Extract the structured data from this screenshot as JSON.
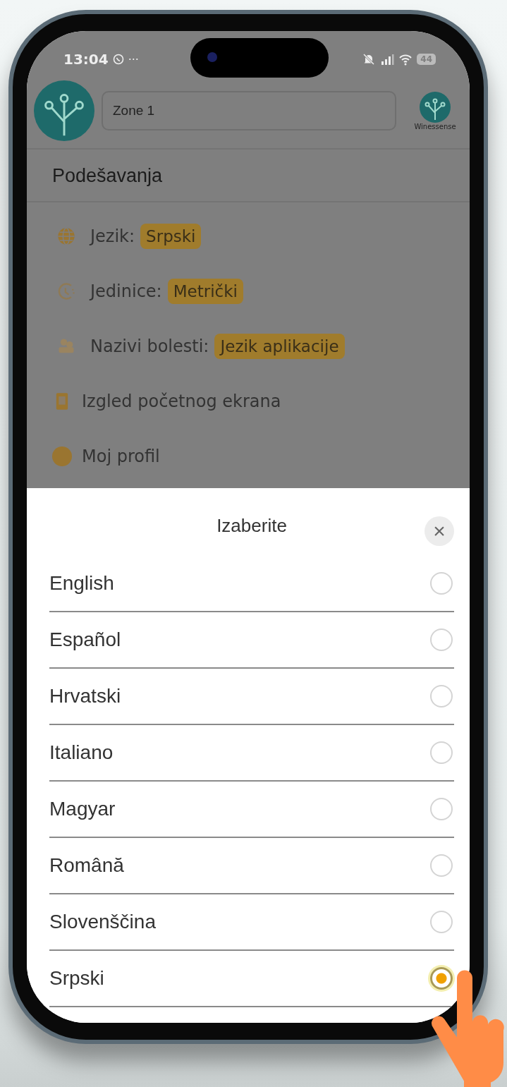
{
  "status_bar": {
    "time": "13:04",
    "more": "···",
    "battery": "44"
  },
  "header": {
    "zone_field": {
      "value": "Zone 1"
    },
    "brand_label": "Winessense"
  },
  "title": "Podešavanja",
  "settings": [
    {
      "kind": "globe",
      "label": "Jezik:",
      "value": "Srpski"
    },
    {
      "kind": "units",
      "label": "Jedinice:",
      "value": "Metrički"
    },
    {
      "kind": "disease",
      "label": "Nazivi bolesti:",
      "value": "Jezik aplikacije"
    },
    {
      "kind": "screen",
      "label": "Izgled početnog ekrana"
    },
    {
      "kind": "profile",
      "label": "Moj profil"
    }
  ],
  "sheet": {
    "title": "Izaberite",
    "close": "×",
    "options": [
      {
        "label": "English",
        "selected": false
      },
      {
        "label": "Español",
        "selected": false
      },
      {
        "label": "Hrvatski",
        "selected": false
      },
      {
        "label": "Italiano",
        "selected": false
      },
      {
        "label": "Magyar",
        "selected": false
      },
      {
        "label": "Română",
        "selected": false
      },
      {
        "label": "Slovenščina",
        "selected": false
      },
      {
        "label": "Srpski",
        "selected": true
      }
    ]
  }
}
